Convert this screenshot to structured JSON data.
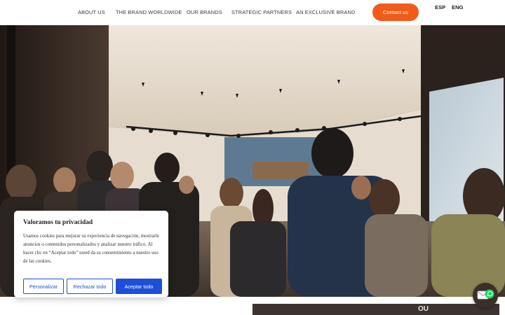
{
  "header": {
    "nav": [
      {
        "label": "ABOUT US"
      },
      {
        "label": "THE BRAND WORLDWIDE"
      },
      {
        "label": "OUR BRANDS"
      },
      {
        "label": "STRATEGIC PARTNERS"
      },
      {
        "label": "AN EXCLUSIVE BRAND"
      }
    ],
    "contact_label": "Contact us",
    "languages": [
      "ESP",
      "ENG"
    ],
    "accent_color": "#f25a1a"
  },
  "cookie_banner": {
    "title": "Valoramos tu privacidad",
    "text": "Usamos cookies para mejorar su experiencia de navegación, mostrarle anuncios o contenidos personalizados y analizar nuestro tráfico. Al hacer clic en “Aceptar todo” usted da su consentimiento a nuestro uso de las cookies.",
    "buttons": {
      "customize": "Personalizar",
      "reject": "Rechazar todo",
      "accept": "Aceptar todo"
    },
    "button_color": "#1d4fd8"
  },
  "lower_photo": {
    "sign_text": "OU"
  },
  "widget": {
    "icon": "mail-whatsapp-icon"
  }
}
